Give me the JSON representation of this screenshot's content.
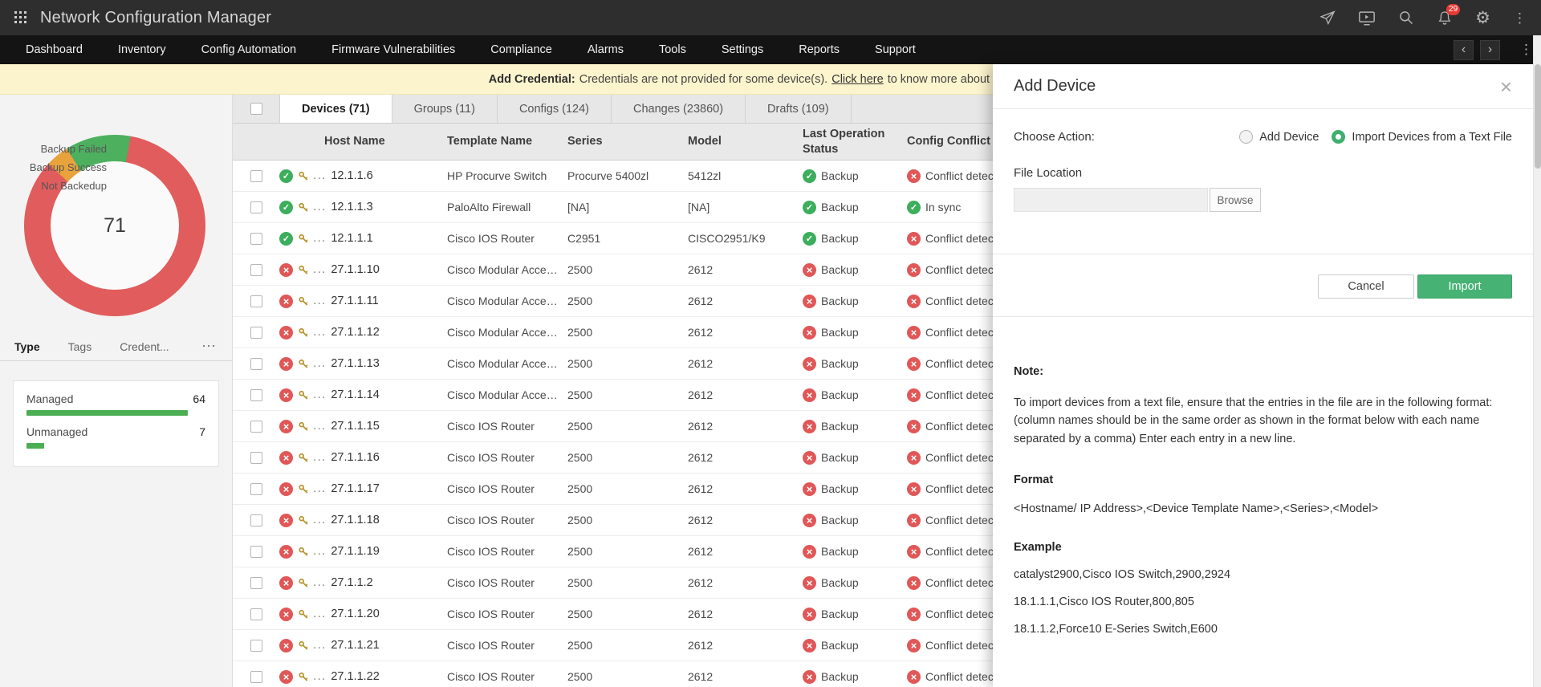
{
  "header": {
    "title": "Network Configuration Manager",
    "badge": "29"
  },
  "icons": {
    "close": "×",
    "gear": "⚙",
    "kebab": "⋮",
    "more": "⋯",
    "prev": "‹",
    "next": "›"
  },
  "nav": {
    "items": [
      "Dashboard",
      "Inventory",
      "Config Automation",
      "Firmware Vulnerabilities",
      "Compliance",
      "Alarms",
      "Tools",
      "Settings",
      "Reports",
      "Support"
    ]
  },
  "banner": {
    "bold": "Add Credential:",
    "text": "Credentials are not provided for some device(s).",
    "link": "Click here",
    "suffix": "to know more about credentials."
  },
  "chart_data": {
    "type": "pie",
    "labels": [
      "Backup Failed",
      "Backup Success",
      "Not Backedup"
    ],
    "values": [
      60,
      8,
      3
    ],
    "center_label": "71",
    "colors": [
      "#e15c5c",
      "#4db05f",
      "#e8a33d"
    ],
    "legend_position": "top-left"
  },
  "sidebar": {
    "chart": {
      "legend": [
        "Backup Failed",
        "Backup Success",
        "Not Backedup"
      ],
      "center": "71"
    },
    "subtabs": [
      {
        "label": "Type",
        "active": true
      },
      {
        "label": "Tags",
        "active": false
      },
      {
        "label": "Credent...",
        "active": false
      }
    ],
    "stats": [
      {
        "label": "Managed",
        "value": "64",
        "pct": 90
      },
      {
        "label": "Unmanaged",
        "value": "7",
        "pct": 10
      }
    ]
  },
  "main": {
    "tabs": [
      {
        "label": "Devices (71)",
        "active": true
      },
      {
        "label": "Groups (11)",
        "active": false
      },
      {
        "label": "Configs (124)",
        "active": false
      },
      {
        "label": "Changes (23860)",
        "active": false
      },
      {
        "label": "Drafts (109)",
        "active": false
      }
    ],
    "table": {
      "ellipsis": "...",
      "columns": [
        "Host Name",
        "Template Name",
        "Series",
        "Model",
        "Last Operation Status",
        "Config Conflict"
      ],
      "rows": [
        {
          "host": "12.1.1.6",
          "template": "HP Procurve Switch",
          "series": "Procurve 5400zl",
          "model": "5412zl",
          "status": "ok",
          "last_op": "Backup",
          "last_op_state": "ok",
          "conflict": "Conflict detected",
          "conflict_state": "err"
        },
        {
          "host": "12.1.1.3",
          "template": "PaloAlto Firewall",
          "series": "[NA]",
          "model": "[NA]",
          "status": "ok",
          "last_op": "Backup",
          "last_op_state": "ok",
          "conflict": "In sync",
          "conflict_state": "ok"
        },
        {
          "host": "12.1.1.1",
          "template": "Cisco IOS Router",
          "series": "C2951",
          "model": "CISCO2951/K9",
          "status": "ok",
          "last_op": "Backup",
          "last_op_state": "ok",
          "conflict": "Conflict detected",
          "conflict_state": "err"
        },
        {
          "host": "27.1.1.10",
          "template": "Cisco Modular Acces...",
          "series": "2500",
          "model": "2612",
          "status": "err",
          "last_op": "Backup",
          "last_op_state": "err",
          "conflict": "Conflict detected",
          "conflict_state": "err"
        },
        {
          "host": "27.1.1.11",
          "template": "Cisco Modular Acces...",
          "series": "2500",
          "model": "2612",
          "status": "err",
          "last_op": "Backup",
          "last_op_state": "err",
          "conflict": "Conflict detected",
          "conflict_state": "err"
        },
        {
          "host": "27.1.1.12",
          "template": "Cisco Modular Acces...",
          "series": "2500",
          "model": "2612",
          "status": "err",
          "last_op": "Backup",
          "last_op_state": "err",
          "conflict": "Conflict detected",
          "conflict_state": "err"
        },
        {
          "host": "27.1.1.13",
          "template": "Cisco Modular Acces...",
          "series": "2500",
          "model": "2612",
          "status": "err",
          "last_op": "Backup",
          "last_op_state": "err",
          "conflict": "Conflict detected",
          "conflict_state": "err"
        },
        {
          "host": "27.1.1.14",
          "template": "Cisco Modular Acces...",
          "series": "2500",
          "model": "2612",
          "status": "err",
          "last_op": "Backup",
          "last_op_state": "err",
          "conflict": "Conflict detected",
          "conflict_state": "err"
        },
        {
          "host": "27.1.1.15",
          "template": "Cisco IOS Router",
          "series": "2500",
          "model": "2612",
          "status": "err",
          "last_op": "Backup",
          "last_op_state": "err",
          "conflict": "Conflict detected",
          "conflict_state": "err"
        },
        {
          "host": "27.1.1.16",
          "template": "Cisco IOS Router",
          "series": "2500",
          "model": "2612",
          "status": "err",
          "last_op": "Backup",
          "last_op_state": "err",
          "conflict": "Conflict detected",
          "conflict_state": "err"
        },
        {
          "host": "27.1.1.17",
          "template": "Cisco IOS Router",
          "series": "2500",
          "model": "2612",
          "status": "err",
          "last_op": "Backup",
          "last_op_state": "err",
          "conflict": "Conflict detected",
          "conflict_state": "err"
        },
        {
          "host": "27.1.1.18",
          "template": "Cisco IOS Router",
          "series": "2500",
          "model": "2612",
          "status": "err",
          "last_op": "Backup",
          "last_op_state": "err",
          "conflict": "Conflict detected",
          "conflict_state": "err"
        },
        {
          "host": "27.1.1.19",
          "template": "Cisco IOS Router",
          "series": "2500",
          "model": "2612",
          "status": "err",
          "last_op": "Backup",
          "last_op_state": "err",
          "conflict": "Conflict detected",
          "conflict_state": "err"
        },
        {
          "host": "27.1.1.2",
          "template": "Cisco IOS Router",
          "series": "2500",
          "model": "2612",
          "status": "err",
          "last_op": "Backup",
          "last_op_state": "err",
          "conflict": "Conflict detected",
          "conflict_state": "err"
        },
        {
          "host": "27.1.1.20",
          "template": "Cisco IOS Router",
          "series": "2500",
          "model": "2612",
          "status": "err",
          "last_op": "Backup",
          "last_op_state": "err",
          "conflict": "Conflict detected",
          "conflict_state": "err"
        },
        {
          "host": "27.1.1.21",
          "template": "Cisco IOS Router",
          "series": "2500",
          "model": "2612",
          "status": "err",
          "last_op": "Backup",
          "last_op_state": "err",
          "conflict": "Conflict detected",
          "conflict_state": "err"
        },
        {
          "host": "27.1.1.22",
          "template": "Cisco IOS Router",
          "series": "2500",
          "model": "2612",
          "status": "err",
          "last_op": "Backup",
          "last_op_state": "err",
          "conflict": "Conflict detected",
          "conflict_state": "err"
        }
      ]
    }
  },
  "panel": {
    "title": "Add Device",
    "choose_action_label": "Choose Action:",
    "radios": [
      {
        "label": "Add Device",
        "selected": false
      },
      {
        "label": "Import Devices from a Text File",
        "selected": true
      }
    ],
    "file_location_label": "File Location",
    "file_input_value": "",
    "browse_label": "Browse",
    "cancel_label": "Cancel",
    "import_label": "Import",
    "note_title": "Note:",
    "note_text": "To import devices from a text file, ensure that the entries in the file are in the following format: (column names should be in the same order as shown in the format below with each name separated by a comma) Enter each entry in a new line.",
    "format_title": "Format",
    "format_text": "<Hostname/ IP Address>,<Device Template Name>,<Series>,<Model>",
    "example_title": "Example",
    "examples": [
      "catalyst2900,Cisco IOS Switch,2900,2924",
      "18.1.1.1,Cisco IOS Router,800,805",
      "18.1.1.2,Force10 E-Series Switch,E600"
    ]
  }
}
